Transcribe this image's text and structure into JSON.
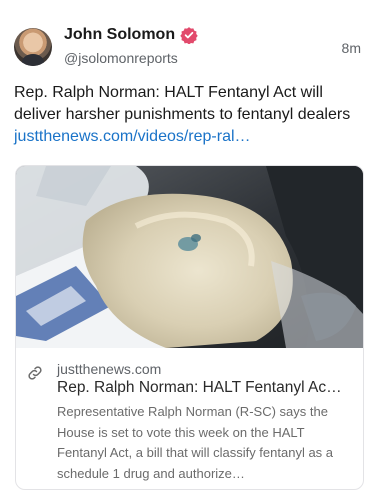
{
  "post": {
    "author": {
      "name": "John Solomon",
      "handle": "@jsolomonreports"
    },
    "timestamp": "8m",
    "text": "Rep. Ralph Norman: HALT Fentanyl Act will deliver harsher punishments to fentanyl dealers",
    "link_text": "justthenews.com/videos/rep-ral…",
    "link_card": {
      "domain": "justthenews.com",
      "title": "Rep. Ralph Norman: HALT Fentanyl Ac…",
      "description": "Representative Ralph Norman (R-SC) says the House is set to vote this week on the HALT Fentanyl Act, a bill that will classify fentanyl as a schedule 1 drug and authorize…"
    }
  },
  "icons": {
    "verified": "verified-badge-icon",
    "link": "link-chain-icon"
  },
  "colors": {
    "verified_badge": "#e24a6c",
    "link": "#1a73c8",
    "secondary_text": "#5f6368"
  }
}
